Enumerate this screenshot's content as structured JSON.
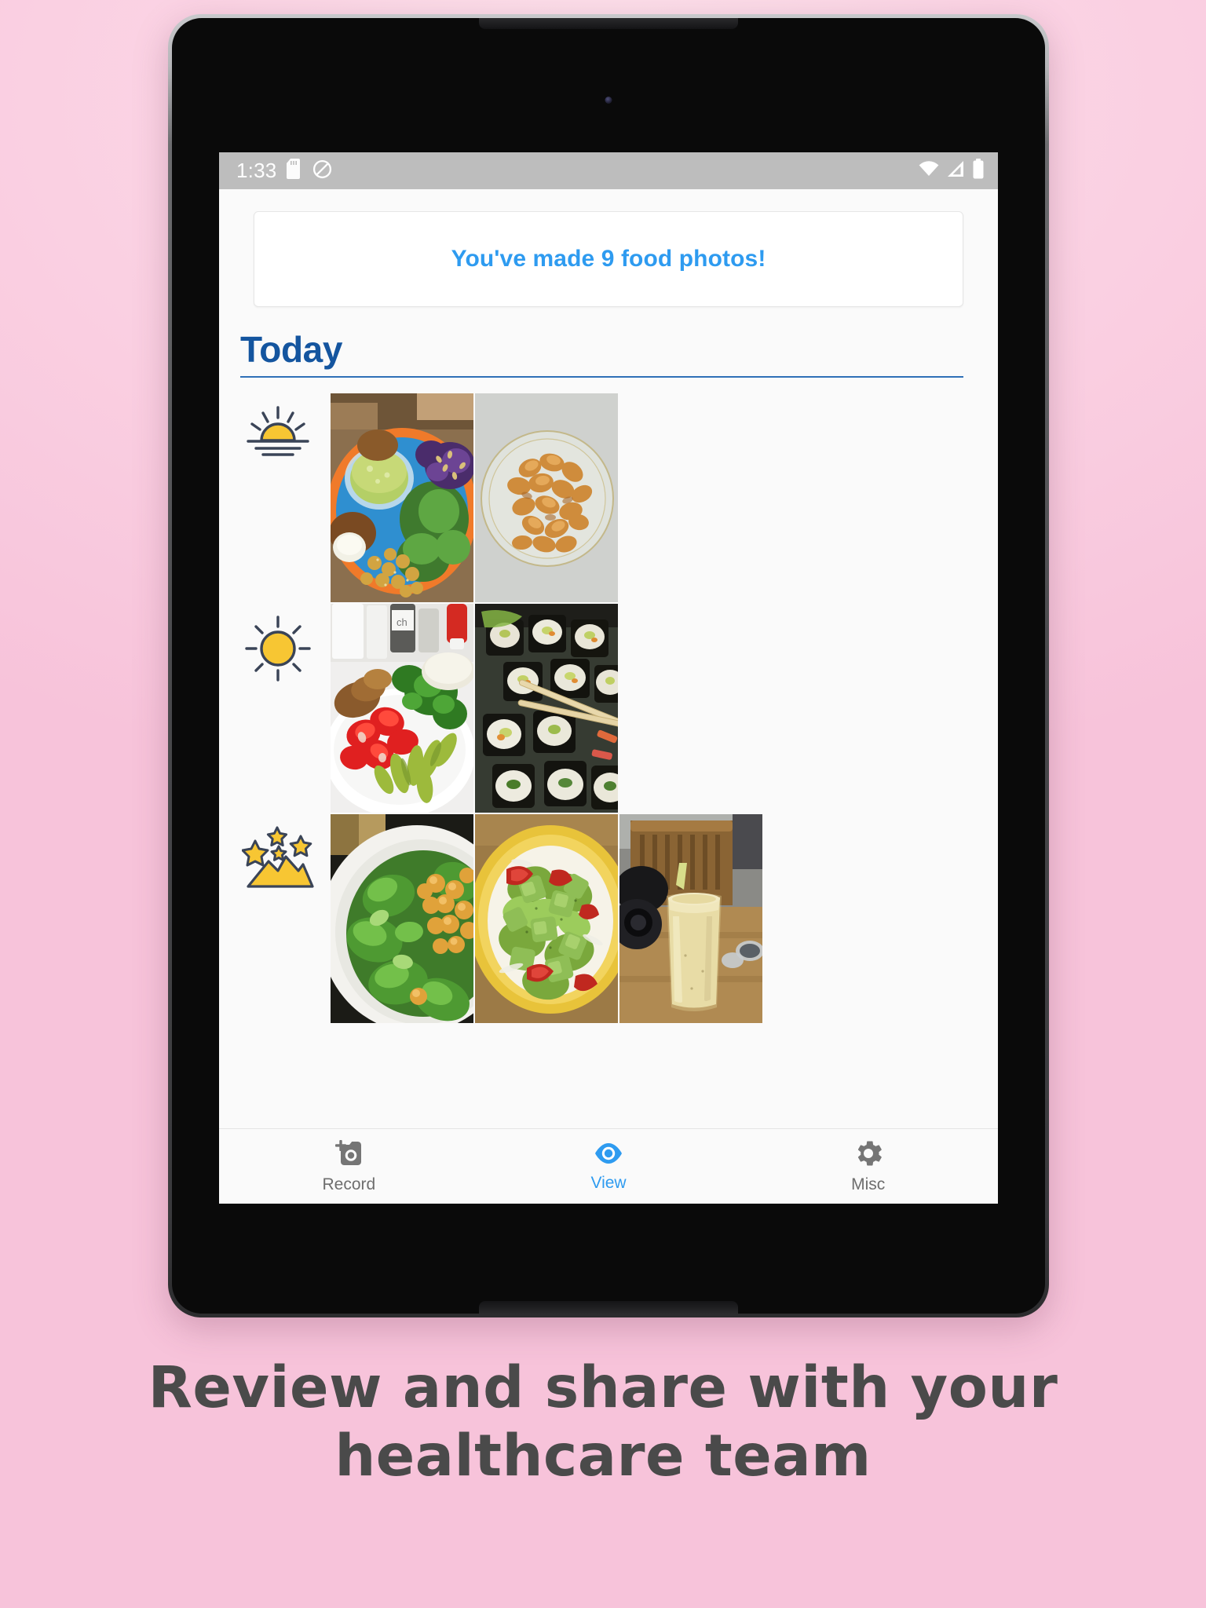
{
  "caption": {
    "line1": "Review and share with your",
    "line2": "healthcare team"
  },
  "statusbar": {
    "time": "1:33",
    "icons": [
      "sd-card-icon",
      "do-not-disturb-icon",
      "wifi-icon",
      "cell-signal-icon",
      "battery-icon"
    ]
  },
  "app": {
    "banner": {
      "text": "You've made 9 food photos!",
      "color": "#2e9bf0",
      "count": 9
    },
    "day_section": {
      "title": "Today",
      "title_color": "#14559f",
      "underline_color": "#2e6fb7"
    },
    "meals": [
      {
        "name": "breakfast",
        "icon": "sunrise-icon",
        "photos": [
          {
            "alt": "falafel chickpea salad plate with green smoothie"
          },
          {
            "alt": "glass bowl of roasted cashews"
          }
        ]
      },
      {
        "name": "lunch",
        "icon": "sun-icon",
        "photos": [
          {
            "alt": "plate with seitan, cherry tomatoes and pickled peppers"
          },
          {
            "alt": "sushi maki rolls with chopsticks"
          }
        ]
      },
      {
        "name": "dinner",
        "icon": "mountains-stars-icon",
        "photos": [
          {
            "alt": "bowl of lamb's lettuce with chickpeas"
          },
          {
            "alt": "avocado and tomato salad on yellow plate"
          },
          {
            "alt": "tall glass of smoothie with straw"
          }
        ]
      }
    ],
    "bottom_nav": [
      {
        "id": "record",
        "label": "Record",
        "icon": "add-photo-camera-icon",
        "active": false
      },
      {
        "id": "view",
        "label": "View",
        "icon": "eye-icon",
        "active": true
      },
      {
        "id": "misc",
        "label": "Misc",
        "icon": "gear-icon",
        "active": false
      }
    ]
  },
  "theme": {
    "accent_blue": "#2e9bf0",
    "heading_blue": "#14559f",
    "icon_yellow": "#f7c633",
    "icon_outline": "#3a4457",
    "statusbar_gray": "#bdbdbd",
    "page_pink": "#f8c9de"
  }
}
